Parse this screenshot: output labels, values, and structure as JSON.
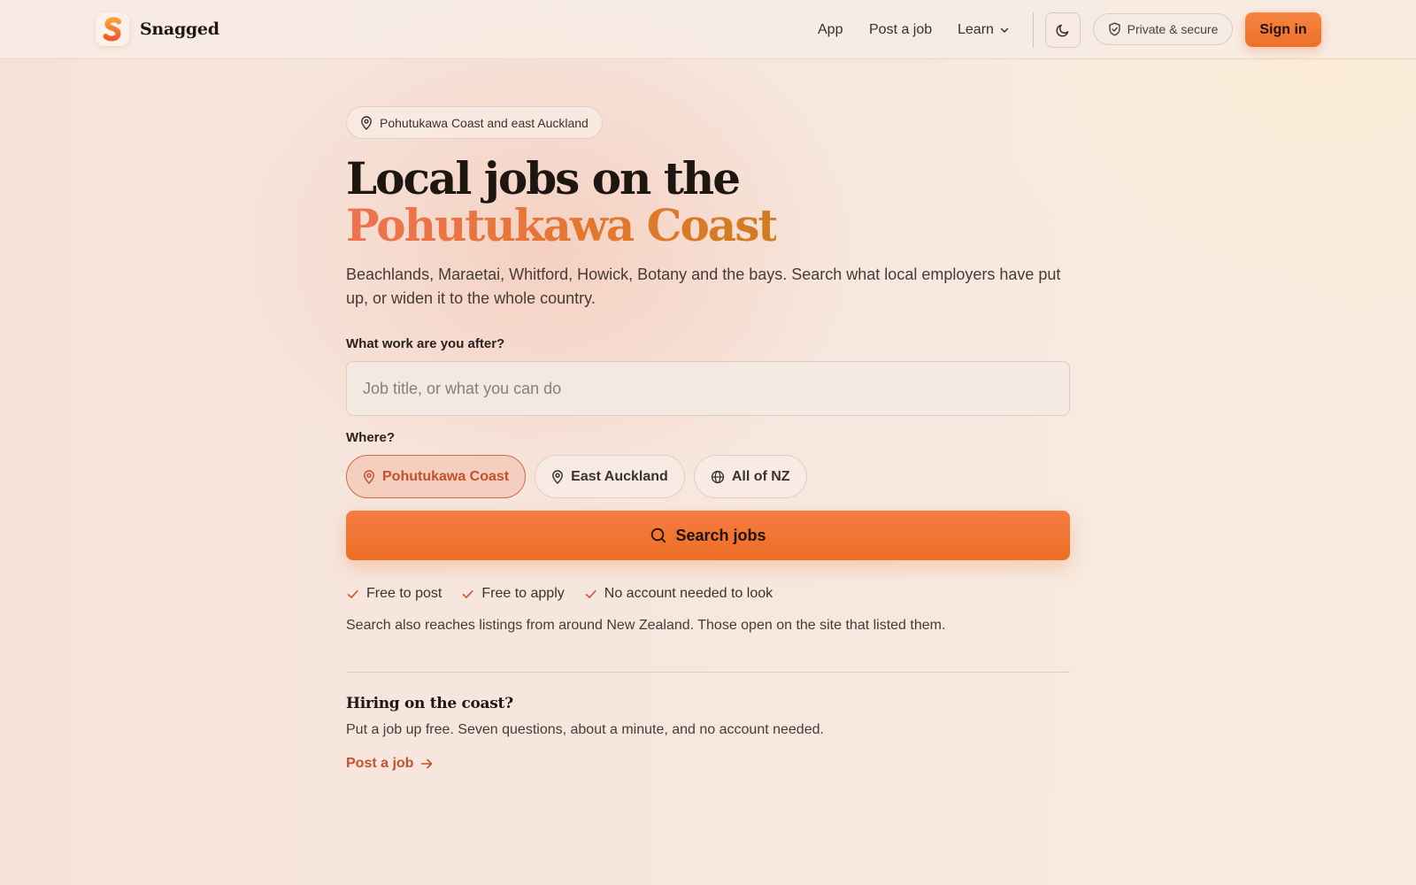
{
  "header": {
    "brand": "Snagged",
    "nav": {
      "app": "App",
      "post_job": "Post a job",
      "learn": "Learn"
    },
    "secure_badge": "Private & secure",
    "sign_in": "Sign in"
  },
  "hero": {
    "location_chip": "Pohutukawa Coast and east Auckland",
    "title_line1": "Local jobs on the",
    "title_line2": "Pohutukawa Coast",
    "subtitle": "Beachlands, Maraetai, Whitford, Howick, Botany and the bays. Search what local employers have put up, or widen it to the whole country."
  },
  "search": {
    "work_label": "What work are you after?",
    "work_placeholder": "Job title, or what you can do",
    "work_value": "",
    "where_label": "Where?",
    "where_options": [
      {
        "label": "Pohutukawa Coast",
        "icon": "map-pin-icon",
        "selected": true
      },
      {
        "label": "East Auckland",
        "icon": "map-pin-icon",
        "selected": false
      },
      {
        "label": "All of NZ",
        "icon": "globe-icon",
        "selected": false
      }
    ],
    "button": "Search jobs"
  },
  "perks": [
    "Free to post",
    "Free to apply",
    "No account needed to look"
  ],
  "note": "Search also reaches listings from around New Zealand. Those open on the site that listed them.",
  "hiring": {
    "title": "Hiring on the coast?",
    "text": "Put a job up free. Seven questions, about a minute, and no account needed.",
    "link": "Post a job"
  },
  "colors": {
    "accent": "#ee6f2a",
    "accent_text": "#c7512c",
    "heading": "#1e1611"
  }
}
